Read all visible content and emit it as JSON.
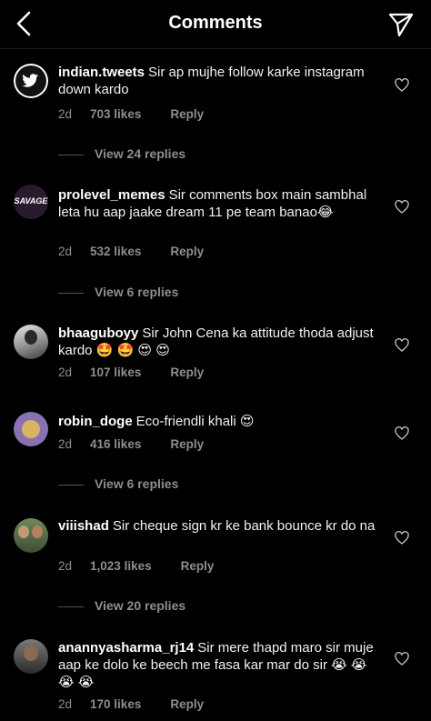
{
  "header": {
    "title": "Comments",
    "back_icon": "chevron-left-icon",
    "send_icon": "send-icon"
  },
  "comments": [
    {
      "username": "indian.tweets",
      "text": "Sir ap mujhe follow karke instagram down kardo",
      "emojis": "",
      "age": "2d",
      "likes": "703 likes",
      "reply": "Reply",
      "replies": "View 24 replies",
      "avatar": "twitter-bird-avatar"
    },
    {
      "username": "prolevel_memes",
      "text": "Sir comments box main sambhal leta hu aap jaake dream 11 pe team banao",
      "emojis": "😂",
      "age": "2d",
      "likes": "532 likes",
      "reply": "Reply",
      "replies": "View 6 replies",
      "avatar": "savage-logo-avatar",
      "avatar_text": "SAVAGE"
    },
    {
      "username": "bhaaguboyy",
      "text": "Sir John Cena ka attitude thoda adjust kardo",
      "emojis": "🤩 🤩 😍 😍",
      "age": "2d",
      "likes": "107 likes",
      "reply": "Reply",
      "replies": "",
      "avatar": "photo-avatar"
    },
    {
      "username": "robin_doge",
      "text": "Eco-friendli khali",
      "emojis": "😍",
      "age": "2d",
      "likes": "416 likes",
      "reply": "Reply",
      "replies": "View 6 replies",
      "avatar": "doge-avatar"
    },
    {
      "username": "viiishad",
      "text": "Sir cheque sign kr ke bank bounce kr do na",
      "emojis": "",
      "age": "2d",
      "likes": "1,023 likes",
      "reply": "Reply",
      "replies": "View 20 replies",
      "avatar": "photo-avatar"
    },
    {
      "username": "anannyasharma_rj14",
      "text": "Sir mere thapd maro sir muje aap ke dolo ke beech me fasa kar mar do sir",
      "emojis": "😭 😭 😭 😭",
      "age": "2d",
      "likes": "170 likes",
      "reply": "Reply",
      "replies": "",
      "avatar": "photo-avatar"
    }
  ],
  "colors": {
    "background": "#000000",
    "muted": "#8e8e8e",
    "text": "#f5f5f5"
  }
}
